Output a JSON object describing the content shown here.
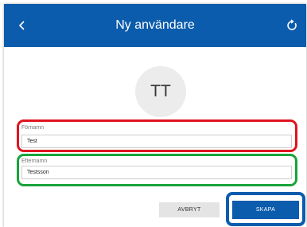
{
  "header": {
    "title": "Ny användare",
    "back_icon": "chevron-left-icon",
    "refresh_icon": "refresh-icon"
  },
  "avatar": {
    "initials": "TT"
  },
  "form": {
    "first_name": {
      "label": "Förnamn",
      "value": "Test"
    },
    "last_name": {
      "label": "Efternamn",
      "value": "Testsson"
    }
  },
  "actions": {
    "cancel_label": "AVBRYT",
    "create_label": "SKAPA"
  },
  "colors": {
    "header_bg": "#0b5cad",
    "highlight_first_name": "#e0141e",
    "highlight_last_name": "#1aa33a",
    "highlight_create": "#0b5cad"
  }
}
